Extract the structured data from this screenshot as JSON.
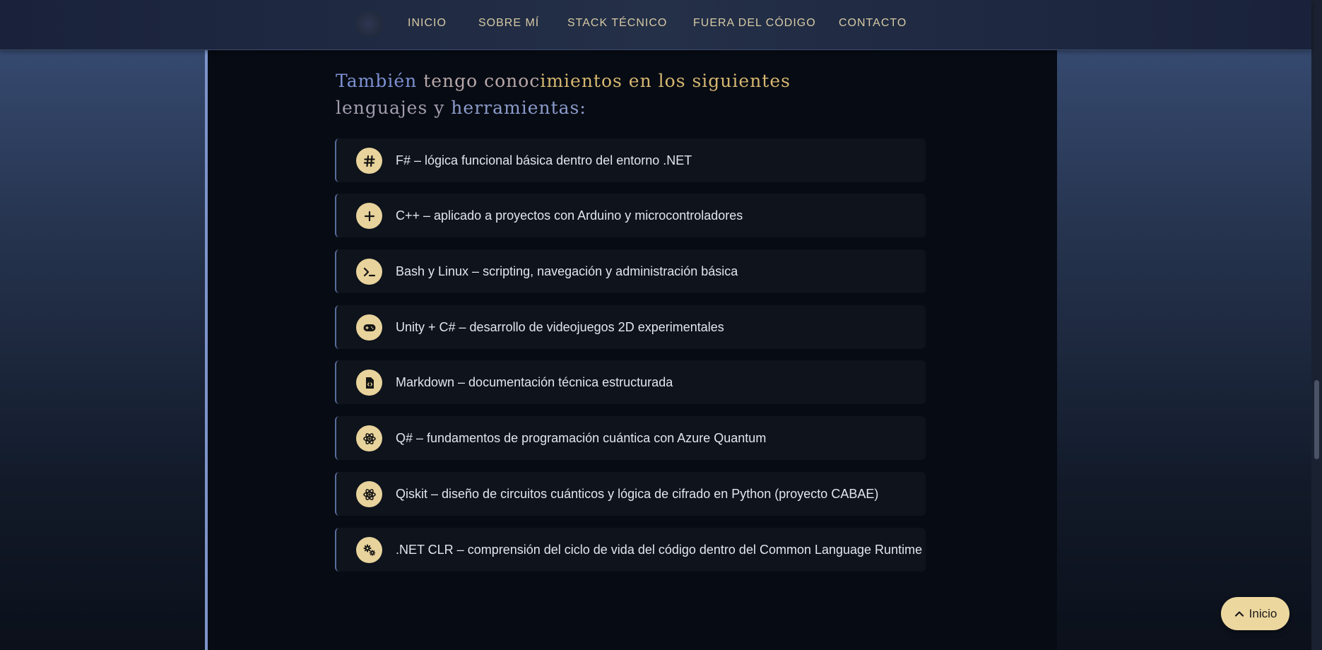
{
  "nav": {
    "links": [
      "INICIO",
      "SOBRE MÍ",
      "STACK TÉCNICO",
      "FUERA DEL CÓDIGO",
      "CONTACTO"
    ]
  },
  "section": {
    "heading_parts": [
      "También ",
      "tengo conoc",
      "imientos en los siguientes ",
      "lenguajes y",
      " herramientas:"
    ]
  },
  "items": [
    {
      "icon": "hash-icon",
      "text": "F# – lógica funcional básica dentro del entorno .NET"
    },
    {
      "icon": "plus-icon",
      "text": "C++ – aplicado a proyectos con Arduino y microcontroladores"
    },
    {
      "icon": "terminal-icon",
      "text": "Bash y Linux – scripting, navegación y administración básica"
    },
    {
      "icon": "gamepad-icon",
      "text": "Unity + C# – desarrollo de videojuegos 2D experimentales"
    },
    {
      "icon": "file-code-icon",
      "text": "Markdown – documentación técnica estructurada"
    },
    {
      "icon": "atom-icon",
      "text": "Q# – fundamentos de programación cuántica con Azure Quantum"
    },
    {
      "icon": "atom-icon",
      "text": "Qiskit – diseño de circuitos cuánticos y lógica de cifrado en Python (proyecto CABAE)"
    },
    {
      "icon": "gears-icon",
      "text": ".NET CLR – comprensión del ciclo de vida del código dentro del Common Language Runtime"
    }
  ],
  "back_to_top": {
    "label": "Inicio",
    "icon": "chevron-up-icon"
  },
  "colors": {
    "accent": "#e8d39c",
    "panel_border": "#7d94c9",
    "heading": "#8a9bd0"
  }
}
